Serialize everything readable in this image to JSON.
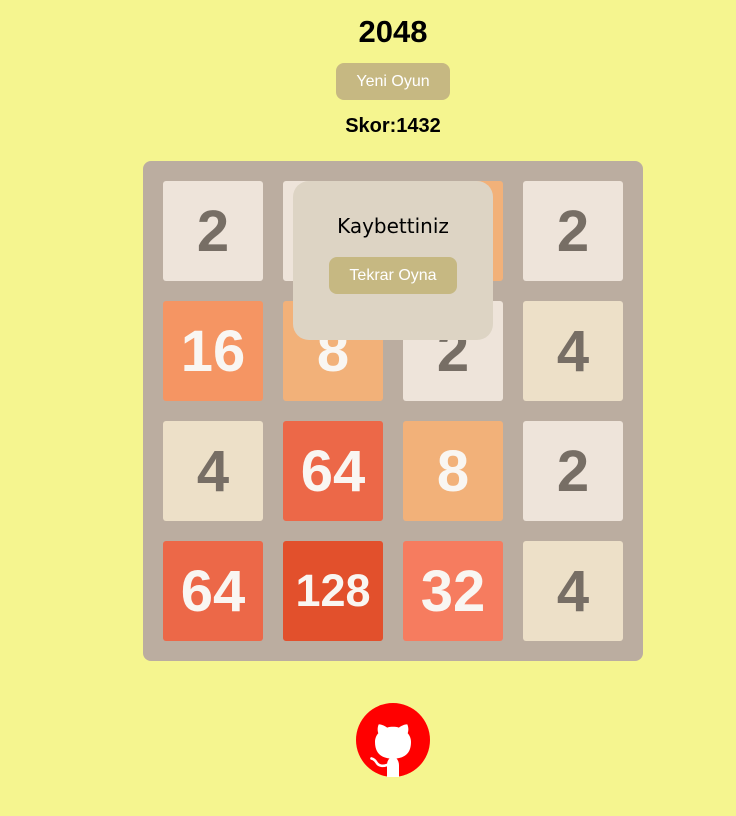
{
  "header": {
    "title": "2048",
    "new_game_label": "Yeni Oyun",
    "score_text": "Skor:1432"
  },
  "board": {
    "rows": [
      [
        "2",
        "",
        "",
        "2"
      ],
      [
        "16",
        "8",
        "2",
        "4"
      ],
      [
        "4",
        "64",
        "8",
        "2"
      ],
      [
        "64",
        "128",
        "32",
        "4"
      ]
    ]
  },
  "overlay": {
    "message": "Kaybettiniz",
    "play_again_label": "Tekrar Oyna"
  },
  "footer": {
    "icon": "github-icon",
    "icon_color": "#ff0000"
  },
  "colors": {
    "background": "#f5f58f",
    "board": "#bbada0",
    "button": "#c6b882",
    "overlay": "#ddd4c4"
  }
}
